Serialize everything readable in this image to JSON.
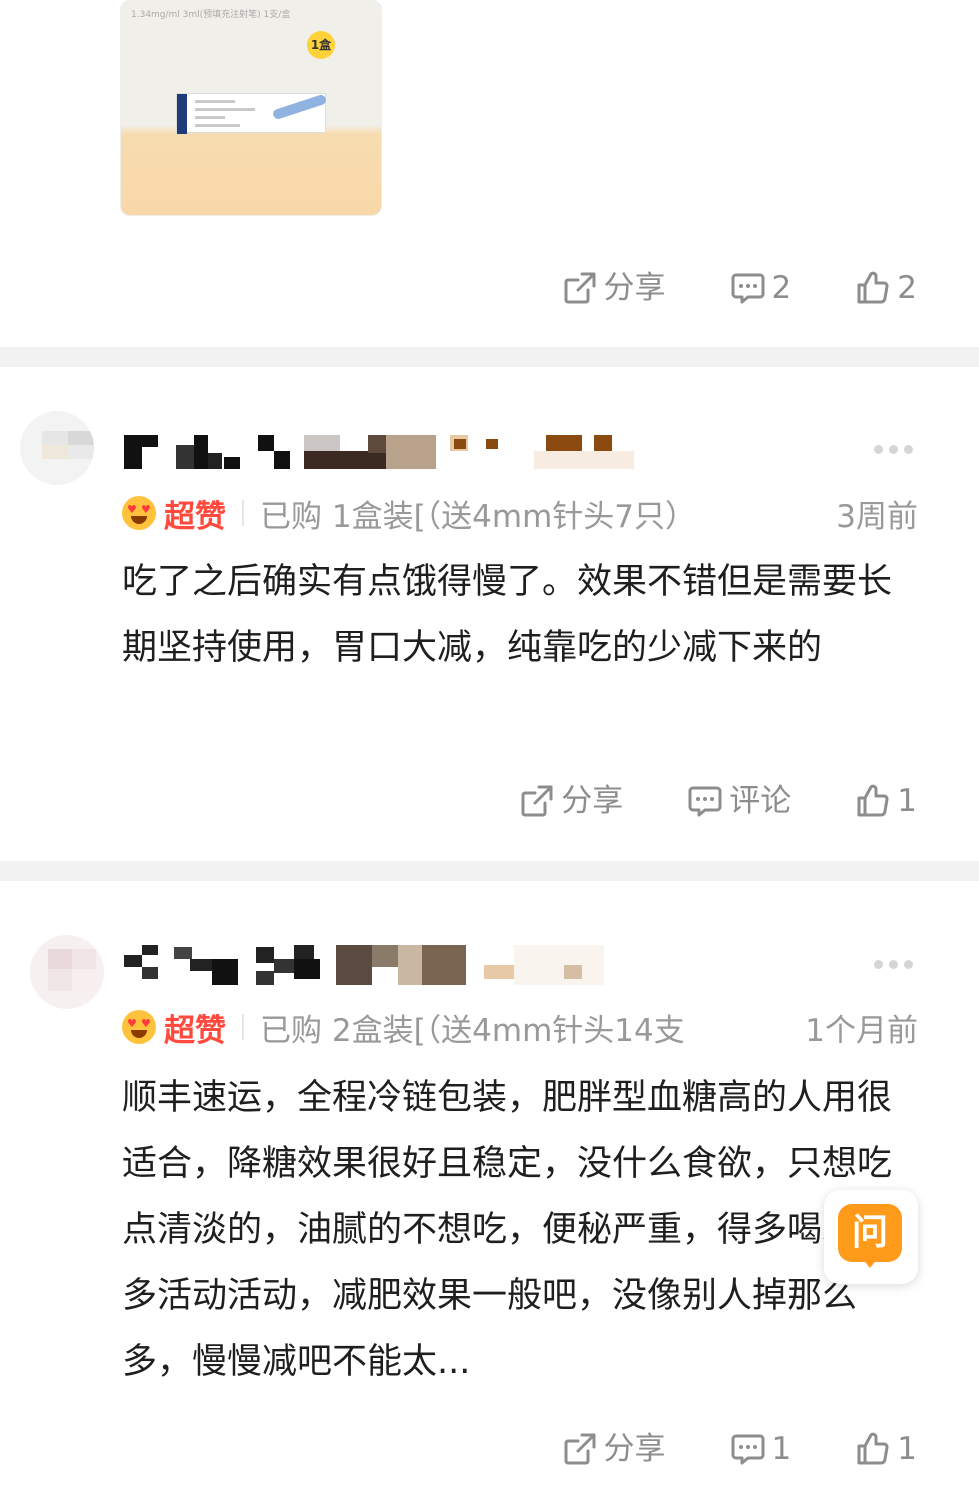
{
  "product": {
    "spec_text": "1.34mg/ml 3ml(预填充注射笔) 1支/盒",
    "qty_badge": "1盒"
  },
  "top_actions": {
    "share_label": "分享",
    "comment_count": "2",
    "like_count": "2"
  },
  "reviews": [
    {
      "badge_label": "超赞",
      "purchased": "已购 1盒装[（送4mm针头7只）",
      "time": "3周前",
      "content": "吃了之后确实有点饿得慢了。效果不错但是需要长期坚持使用，胃口大减，纯靠吃的少减下来的",
      "share_label": "分享",
      "comment_label": "评论",
      "like_count": "1"
    },
    {
      "badge_label": "超赞",
      "purchased": "已购 2盒装[（送4mm针头14支",
      "time": "1个月前",
      "content": "顺丰速运，全程冷链包装，肥胖型血糖高的人用很适合，降糖效果很好且稳定，没什么食欲，只想吃点清淡的，油腻的不想吃，便秘严重，得多喝水，多活动活动，减肥效果一般吧，没像别人掉那么多，慢慢减吧不能太...",
      "share_label": "分享",
      "comment_count": "1",
      "like_count": "1"
    }
  ],
  "ask_button_label": "问",
  "colors": {
    "accent_red": "#ff4a3d",
    "ask_orange": "#ff9a1a",
    "muted_gray": "#999999",
    "divider": "#f2f2f2"
  }
}
